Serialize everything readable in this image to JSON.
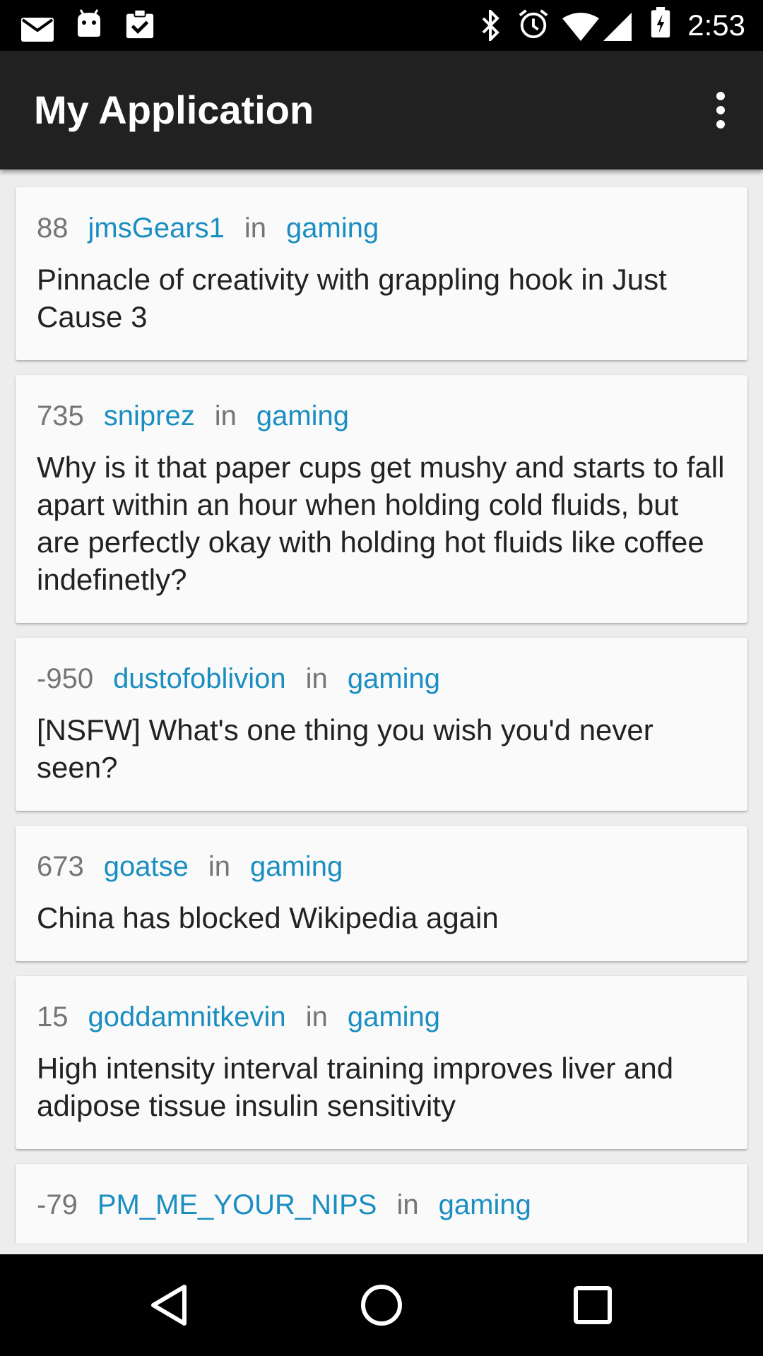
{
  "status_bar": {
    "time": "2:53",
    "left_icons": [
      "mail-icon",
      "android-icon",
      "clipboard-check-icon"
    ],
    "right_icons": [
      "bluetooth-icon",
      "alarm-icon",
      "wifi-icon",
      "signal-icon",
      "battery-charging-icon"
    ]
  },
  "app_bar": {
    "title": "My Application",
    "menu_icon": "more-vert-icon"
  },
  "posts": [
    {
      "score": "88",
      "author": "jmsGears1",
      "in": "in",
      "subreddit": "gaming",
      "title": "Pinnacle of creativity with grappling hook in Just Cause 3"
    },
    {
      "score": "735",
      "author": "sniprez",
      "in": "in",
      "subreddit": "gaming",
      "title": "Why is it that paper cups get mushy and starts to fall apart within an hour when holding cold fluids, but are perfectly okay with holding hot fluids like coffee indefinetly?"
    },
    {
      "score": "-950",
      "author": "dustofoblivion",
      "in": "in",
      "subreddit": "gaming",
      "title": "[NSFW] What's one thing you wish you'd never seen?"
    },
    {
      "score": "673",
      "author": "goatse",
      "in": "in",
      "subreddit": "gaming",
      "title": "China has blocked Wikipedia again"
    },
    {
      "score": "15",
      "author": "goddamnitkevin",
      "in": "in",
      "subreddit": "gaming",
      "title": "High intensity interval training improves liver and adipose tissue insulin sensitivity"
    },
    {
      "score": "-79",
      "author": "PM_ME_YOUR_NIPS",
      "in": "in",
      "subreddit": "gaming",
      "title": ""
    }
  ],
  "colors": {
    "app_bar": "#212121",
    "link": "#1a8ec1",
    "meta": "#757575",
    "card": "#fafafa",
    "background": "#ededed"
  },
  "nav_bar": {
    "icons": [
      "back-icon",
      "home-icon",
      "recents-icon"
    ]
  }
}
